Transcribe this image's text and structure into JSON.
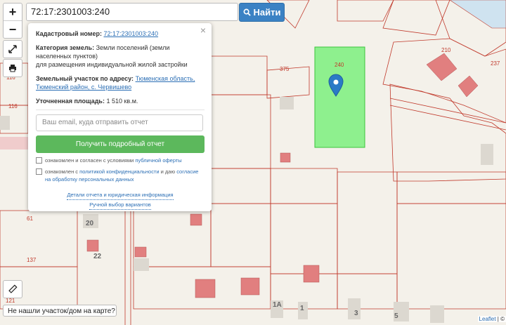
{
  "search": {
    "value": "72:17:2301003:240",
    "button_label": "Найти"
  },
  "zoom": {
    "in_label": "+",
    "out_label": "−"
  },
  "popup": {
    "close_label": "×",
    "cadastral_label": "Кадастровый номер:",
    "cadastral_value": "72:17:2301003:240",
    "category_label": "Категория земель:",
    "category_value": "Земли поселений (земли населенных пунктов)",
    "purpose": "для размещения индивидуальной жилой застройки",
    "address_label": "Земельный участок по адресу:",
    "address_value": "Тюменская область, Тюменский район, с. Червишево",
    "area_label": "Уточненная площадь:",
    "area_value": "1 510 кв.м.",
    "email_placeholder": "Ваш email, куда отправить отчет",
    "report_button": "Получить подробный отчет",
    "consent1_text": "ознакомлен и согласен с условиями ",
    "consent1_link": "публичной оферты",
    "consent2_text": "ознакомлен с ",
    "consent2_link1": "политикой конфиденциальности",
    "consent2_mid": " и даю ",
    "consent2_link2": "согласие на обработку персональных данных",
    "details_link": "Детали отчета и юридическая информация",
    "manual_link": "Ручной выбор вариантов"
  },
  "not_found_button": "Не нашли участок/дом на карте?",
  "attribution": {
    "leaflet": "Leaflet",
    "sep": " | ©"
  },
  "map": {
    "selected_parcel_number": "240",
    "selected_color": "#8ef08e",
    "parcel_numbers": [
      "210",
      "237",
      "375",
      "116",
      "116",
      "61",
      "137",
      "121"
    ],
    "house_numbers": [
      "20",
      "22",
      "1А",
      "1",
      "3",
      "5"
    ],
    "marker_color": "#2b7ac6"
  }
}
